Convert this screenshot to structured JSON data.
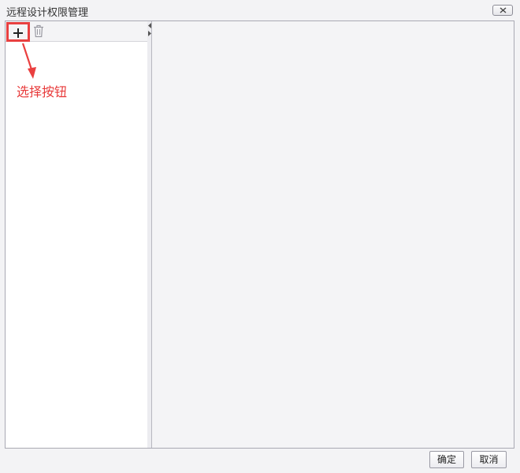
{
  "window": {
    "title": "远程设计权限管理"
  },
  "toolbar": {
    "add_icon": "plus-icon",
    "delete_icon": "trash-icon"
  },
  "annotation": {
    "text": "选择按钮",
    "color": "#e83a3a"
  },
  "footer": {
    "ok_label": "确定",
    "cancel_label": "取消"
  }
}
